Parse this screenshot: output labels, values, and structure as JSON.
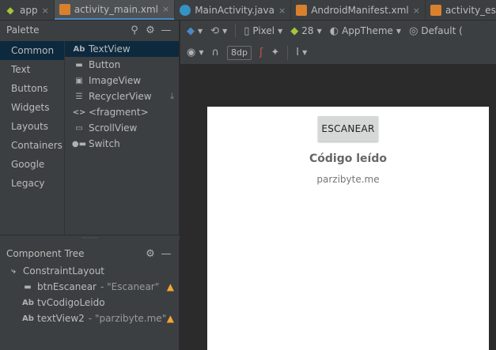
{
  "tabs": [
    {
      "label": "app",
      "icon": "android-icon",
      "close": "×"
    },
    {
      "label": "activity_main.xml",
      "icon": "layout-file-icon",
      "close": "×",
      "active": true
    },
    {
      "label": "MainActivity.java",
      "icon": "java-class-icon",
      "close": "×"
    },
    {
      "label": "AndroidManifest.xml",
      "icon": "manifest-file-icon",
      "close": "×"
    },
    {
      "label": "activity_escanea",
      "icon": "layout-file-icon"
    }
  ],
  "palette": {
    "title": "Palette",
    "categories": [
      "Common",
      "Text",
      "Buttons",
      "Widgets",
      "Layouts",
      "Containers",
      "Google",
      "Legacy"
    ],
    "selected_category": "Common",
    "items": [
      {
        "icon_text": "Ab",
        "label": "TextView",
        "icon": "textview-icon"
      },
      {
        "icon_text": "▬",
        "label": "Button",
        "icon": "button-icon"
      },
      {
        "icon_text": "▣",
        "label": "ImageView",
        "icon": "imageview-icon"
      },
      {
        "icon_text": "☰",
        "label": "RecyclerView",
        "icon": "recyclerview-icon",
        "download": true
      },
      {
        "icon_text": "<>",
        "label": "<fragment>",
        "icon": "fragment-icon"
      },
      {
        "icon_text": "▭",
        "label": "ScrollView",
        "icon": "scrollview-icon"
      },
      {
        "icon_text": "●▬",
        "label": "Switch",
        "icon": "switch-icon"
      }
    ]
  },
  "component_tree": {
    "title": "Component Tree",
    "nodes": [
      {
        "icon_text": "⤷",
        "name": "ConstraintLayout",
        "detail": "",
        "warning": false,
        "level": 0
      },
      {
        "icon_text": "▬",
        "name": "btnEscanear",
        "detail": "- \"Escanear\"",
        "warning": true,
        "level": 1
      },
      {
        "icon_text": "Ab",
        "name": "tvCodigoLeido",
        "detail": "",
        "warning": false,
        "level": 1
      },
      {
        "icon_text": "Ab",
        "name": "textView2",
        "detail": "- \"parzibyte.me\"",
        "warning": true,
        "level": 1
      }
    ]
  },
  "toolbar": {
    "device": "Pixel",
    "api": "28",
    "theme": "AppTheme",
    "locale": "Default (",
    "margin": "8dp"
  },
  "preview": {
    "button_label": "ESCANEAR",
    "heading": "Código leído",
    "footer": "parzibyte.me"
  },
  "colors": {
    "accent": "#4a88c7",
    "warning": "#f0a732",
    "selection": "#0d293e",
    "android_green": "#a4c639"
  }
}
